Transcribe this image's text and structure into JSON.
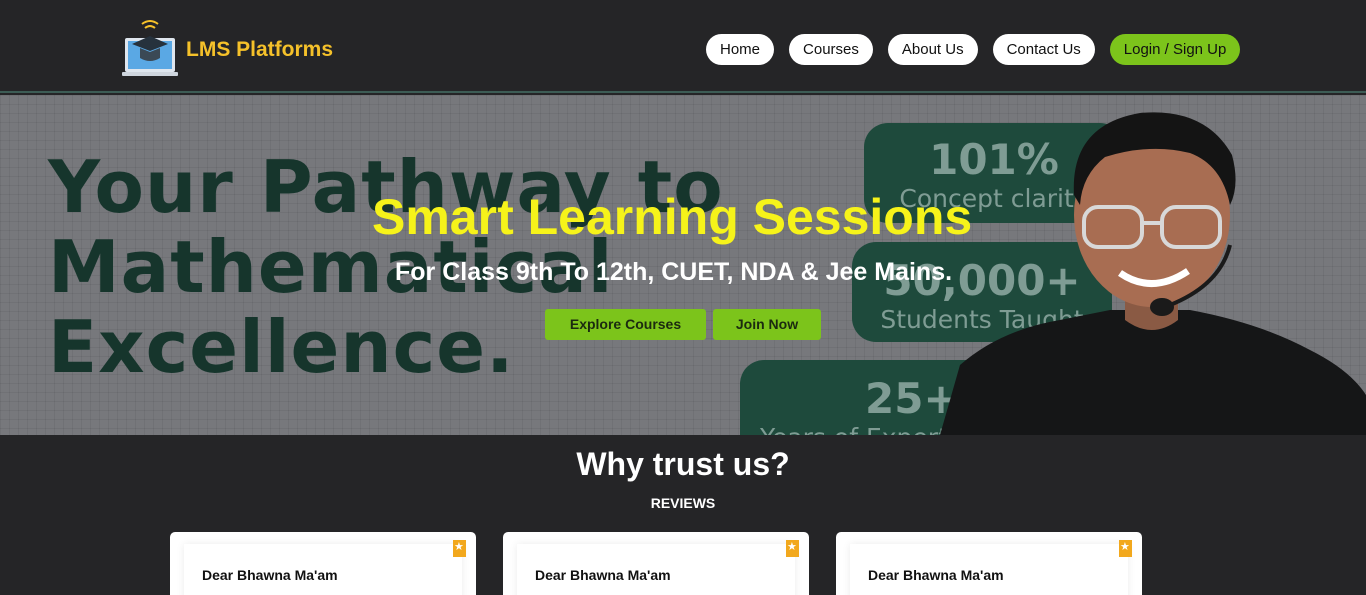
{
  "header": {
    "brand_name": "LMS Platforms",
    "logo_icon": "laptop-graduation-cap-icon",
    "nav": [
      {
        "label": "Home"
      },
      {
        "label": "Courses"
      },
      {
        "label": "About Us"
      },
      {
        "label": "Contact Us"
      },
      {
        "label": "Login / Sign Up"
      }
    ]
  },
  "hero": {
    "background_headline": [
      "Your Pathway to",
      "Mathematical",
      "Excellence."
    ],
    "stats": [
      {
        "value": "101%",
        "label": "Concept clarity"
      },
      {
        "value": "50,000+",
        "label": "Students Taught"
      },
      {
        "value": "25+",
        "label": "Years of Expertise"
      }
    ],
    "title": "Smart Learning Sessions",
    "subtitle": "For Class 9th To 12th, CUET, NDA & Jee Mains.",
    "buttons": {
      "explore": "Explore Courses",
      "join": "Join Now"
    }
  },
  "trust": {
    "title": "Why trust us?",
    "section_label": "REVIEWS",
    "reviews": [
      {
        "name": "Dear Bhawna Ma'am"
      },
      {
        "name": "Dear Bhawna Ma'am"
      },
      {
        "name": "Dear Bhawna Ma'am"
      }
    ]
  },
  "colors": {
    "background": "#252527",
    "brand": "#f5c12a",
    "accent_green": "#7cc41b",
    "hero_title": "#f6f31a"
  }
}
